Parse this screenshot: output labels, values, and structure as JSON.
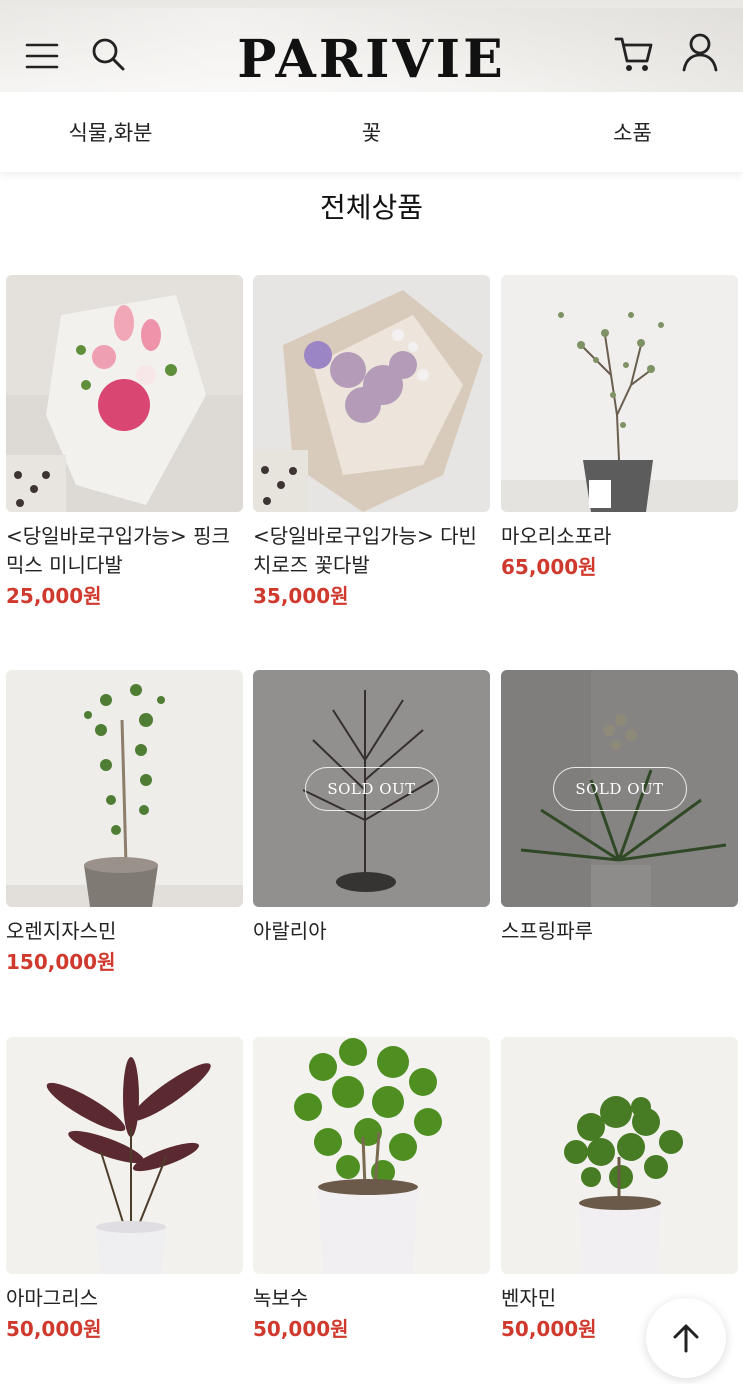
{
  "header": {
    "logo": "PARIVIE",
    "icons": [
      "menu-icon",
      "search-icon",
      "cart-icon",
      "user-icon"
    ]
  },
  "categories": [
    "식물,화분",
    "꽃",
    "소품"
  ],
  "section_title": "전체상품",
  "products": [
    {
      "name": "<당일바로구입가능> 핑크믹스 미니다발",
      "price": "25,000원",
      "sold_out": false
    },
    {
      "name": "<당일바로구입가능> 다빈치로즈 꽃다발",
      "price": "35,000원",
      "sold_out": false
    },
    {
      "name": "마오리소포라",
      "price": "65,000원",
      "sold_out": false
    },
    {
      "name": "오렌지자스민",
      "price": "150,000원",
      "sold_out": false
    },
    {
      "name": "아랄리아",
      "price": "",
      "sold_out": true,
      "badge": "SOLD OUT"
    },
    {
      "name": "스프링파루",
      "price": "",
      "sold_out": true,
      "badge": "SOLD OUT"
    },
    {
      "name": "아마그리스",
      "price": "50,000원",
      "sold_out": false
    },
    {
      "name": "녹보수",
      "price": "50,000원",
      "sold_out": false
    },
    {
      "name": "벤자민",
      "price": "50,000원",
      "sold_out": false
    }
  ],
  "colors": {
    "price": "#d0392d",
    "text": "#222222"
  },
  "scroll_top_icon": "arrow-up-icon"
}
